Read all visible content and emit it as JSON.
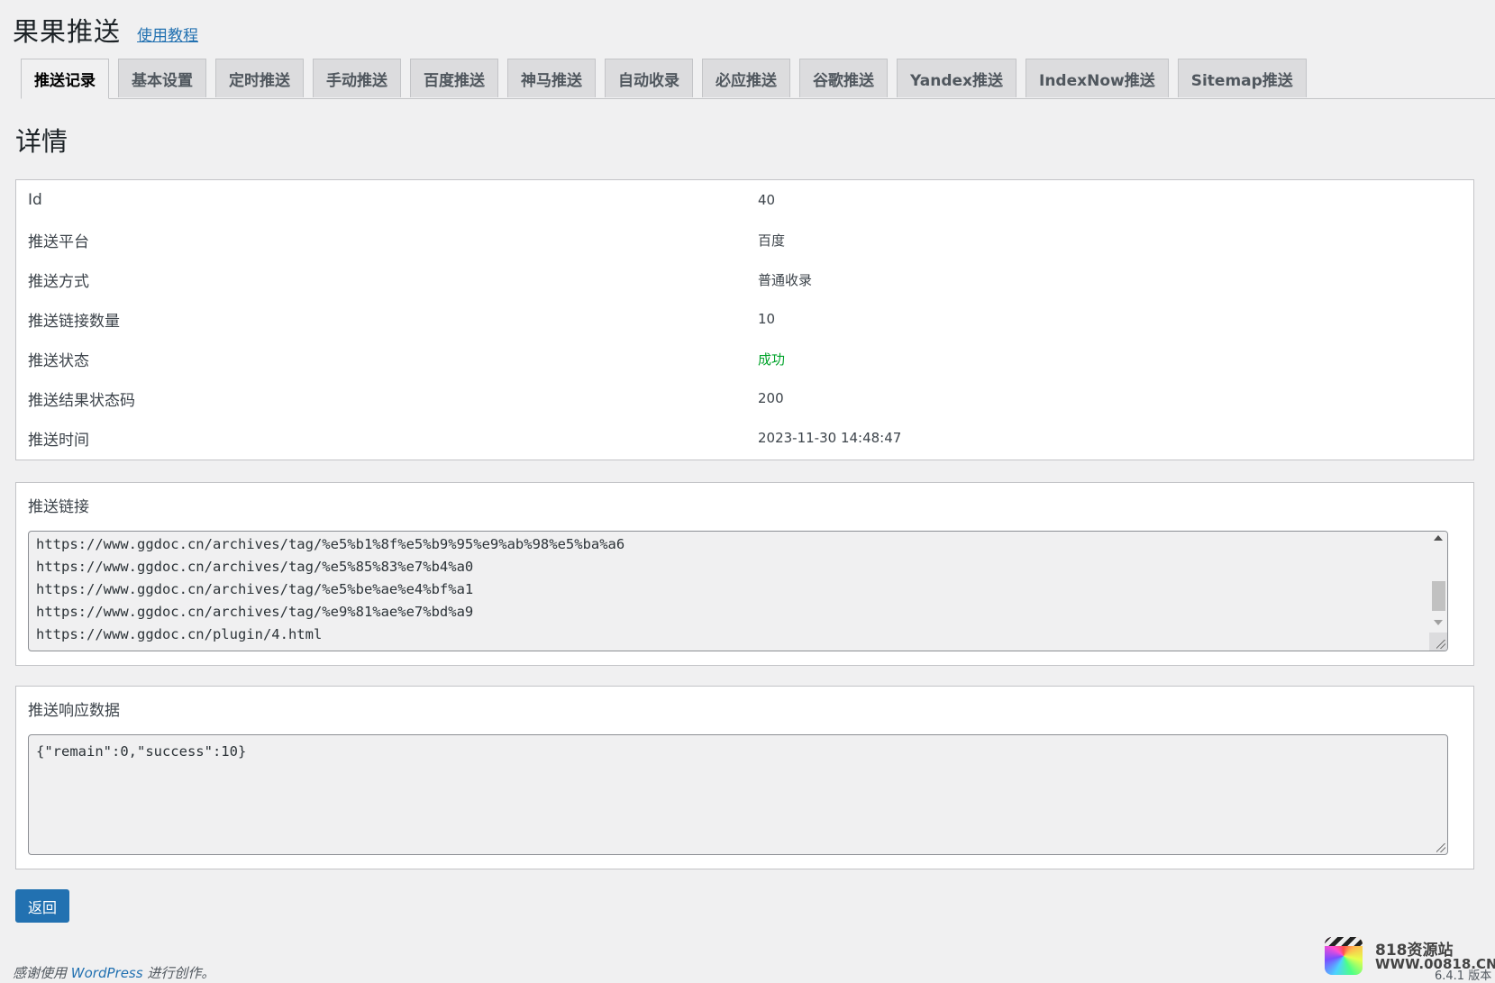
{
  "header": {
    "title": "果果推送",
    "tutorial_link": "使用教程"
  },
  "tabs": [
    {
      "label": "推送记录",
      "active": true
    },
    {
      "label": "基本设置"
    },
    {
      "label": "定时推送"
    },
    {
      "label": "手动推送"
    },
    {
      "label": "百度推送"
    },
    {
      "label": "神马推送"
    },
    {
      "label": "自动收录"
    },
    {
      "label": "必应推送"
    },
    {
      "label": "谷歌推送"
    },
    {
      "label": "Yandex推送"
    },
    {
      "label": "IndexNow推送"
    },
    {
      "label": "Sitemap推送"
    }
  ],
  "section_title": "详情",
  "details": [
    {
      "label": "Id",
      "value": "40"
    },
    {
      "label": "推送平台",
      "value": "百度"
    },
    {
      "label": "推送方式",
      "value": "普通收录"
    },
    {
      "label": "推送链接数量",
      "value": "10"
    },
    {
      "label": "推送状态",
      "value": "成功"
    },
    {
      "label": "推送结果状态码",
      "value": "200"
    },
    {
      "label": "推送时间",
      "value": "2023-11-30 14:48:47"
    }
  ],
  "links": {
    "label": "推送链接",
    "lines": [
      "https://www.ggdoc.cn/archives/tag/%e5%b1%8f%e5%b9%95%e9%ab%98%e5%ba%a6",
      "https://www.ggdoc.cn/archives/tag/%e5%85%83%e7%b4%a0",
      "https://www.ggdoc.cn/archives/tag/%e5%be%ae%e4%bf%a1",
      "https://www.ggdoc.cn/archives/tag/%e9%81%ae%e7%bd%a9",
      "https://www.ggdoc.cn/plugin/4.html"
    ]
  },
  "response": {
    "label": "推送响应数据",
    "value": "{\"remain\":0,\"success\":10}"
  },
  "back_button": "返回",
  "footer": {
    "prefix": "感谢使用",
    "link": "WordPress",
    "suffix": "进行创作。"
  },
  "watermark": {
    "title": "818资源站",
    "url": "WWW.00818.CN"
  },
  "version": "6.4.1 版本"
}
